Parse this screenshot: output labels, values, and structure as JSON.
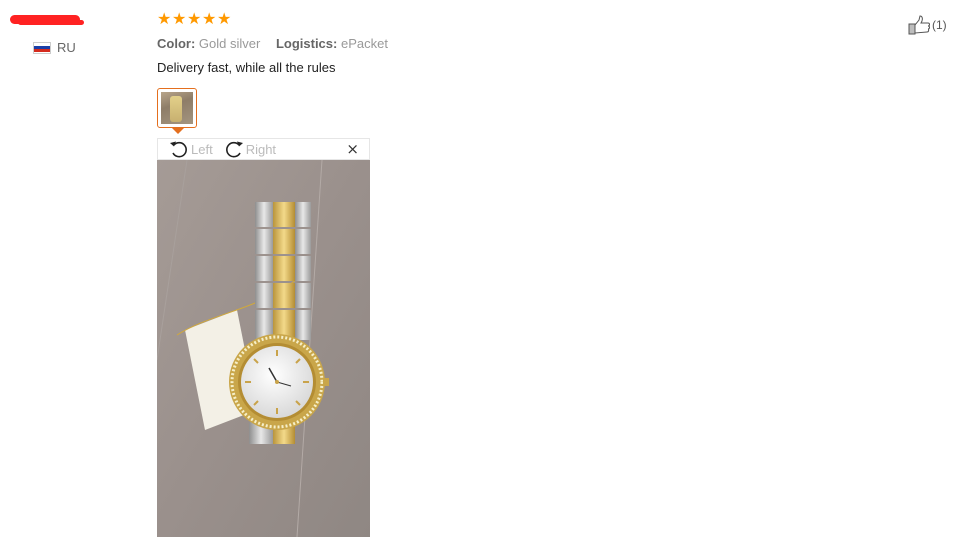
{
  "user": {
    "country_code": "RU"
  },
  "review": {
    "stars": 5,
    "color_label": "Color:",
    "color_value": "Gold silver",
    "logistics_label": "Logistics:",
    "logistics_value": "ePacket",
    "comment": "Delivery fast, while all the rules"
  },
  "viewer": {
    "rotate_left_label": "Left",
    "rotate_right_label": "Right",
    "close_symbol": "×"
  },
  "likes": {
    "count_text": "(1)"
  },
  "colors": {
    "star": "#ff9900",
    "accent_border": "#e46f1e"
  }
}
